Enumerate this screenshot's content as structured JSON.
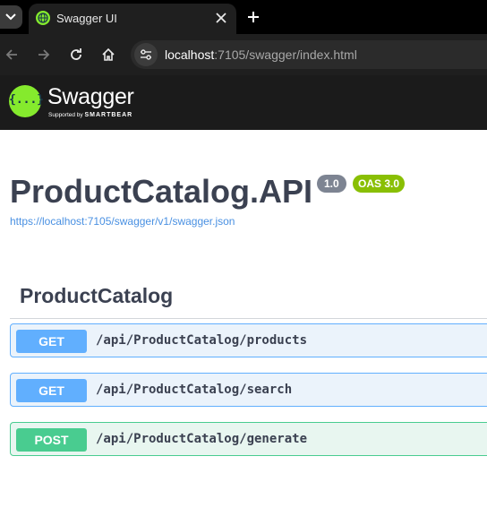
{
  "browser": {
    "tab_title": "Swagger UI",
    "url_host": "localhost",
    "url_rest": ":7105/swagger/index.html",
    "icons": [
      "tab-list-icon",
      "globe-favicon-icon",
      "close-icon",
      "plus-icon",
      "back-arrow-icon",
      "forward-arrow-icon",
      "reload-icon",
      "home-icon",
      "site-settings-icon"
    ]
  },
  "topbar": {
    "logo_mark": "{...}",
    "logo_word": "Swagger",
    "logo_supported_by": "Supported by",
    "logo_brand": "SMARTBEAR"
  },
  "info": {
    "title": "ProductCatalog.API",
    "version": "1.0",
    "oas": "OAS 3.0",
    "spec_url": "https://localhost:7105/swagger/v1/swagger.json"
  },
  "tag": {
    "name": "ProductCatalog",
    "operations": [
      {
        "method": "GET",
        "path": "/api/ProductCatalog/products"
      },
      {
        "method": "GET",
        "path": "/api/ProductCatalog/search"
      },
      {
        "method": "POST",
        "path": "/api/ProductCatalog/generate"
      }
    ]
  },
  "colors": {
    "get": "#61affe",
    "post": "#49cc90",
    "oas_badge": "#89bf04",
    "logo": "#85ea2d"
  }
}
